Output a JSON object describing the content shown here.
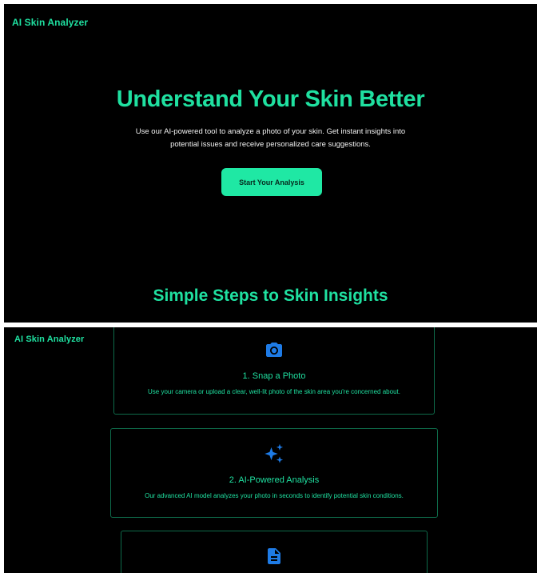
{
  "app": {
    "brand": "AI Skin Analyzer"
  },
  "hero": {
    "title": "Understand Your Skin Better",
    "description": "Use our AI-powered tool to analyze a photo of your skin. Get instant insights into potential issues and receive personalized care suggestions.",
    "cta_label": "Start Your Analysis"
  },
  "steps_section": {
    "title": "Simple Steps to Skin Insights"
  },
  "steps": [
    {
      "icon": "camera-icon",
      "title": "1. Snap a Photo",
      "description": "Use your camera or upload a clear, well-lit photo of the skin area you're concerned about."
    },
    {
      "icon": "sparkles-icon",
      "title": "2. AI-Powered Analysis",
      "description": "Our advanced AI model analyzes your photo in seconds to identify potential skin conditions."
    },
    {
      "icon": "document-icon"
    }
  ],
  "colors": {
    "accent": "#1fe0a0",
    "button": "#1fe8a4",
    "icon": "#1e7be6",
    "background": "#000000",
    "card_border": "#0e6b4a"
  }
}
